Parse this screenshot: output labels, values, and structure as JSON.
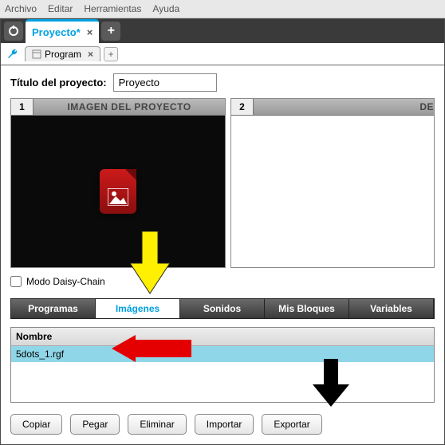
{
  "menubar": {
    "items": [
      "Archivo",
      "Editar",
      "Herramientas",
      "Ayuda"
    ]
  },
  "project_tab": {
    "label": "Proyecto*"
  },
  "program_tab": {
    "label": "Program"
  },
  "title_section": {
    "label": "Título del proyecto:",
    "value": "Proyecto"
  },
  "panel_left": {
    "num": "1",
    "title": "IMAGEN DEL PROYECTO"
  },
  "panel_right": {
    "num": "2",
    "title": "DE"
  },
  "daisy": {
    "label": "Modo Daisy-Chain"
  },
  "lower_tabs": {
    "items": [
      "Programas",
      "Imágenes",
      "Sonidos",
      "Mis Bloques",
      "Variables"
    ],
    "active_index": 1
  },
  "list": {
    "header": "Nombre",
    "rows": [
      "5dots_1.rgf"
    ]
  },
  "buttons": {
    "copy": "Copiar",
    "paste": "Pegar",
    "delete": "Eliminar",
    "import": "Importar",
    "export": "Exportar"
  }
}
